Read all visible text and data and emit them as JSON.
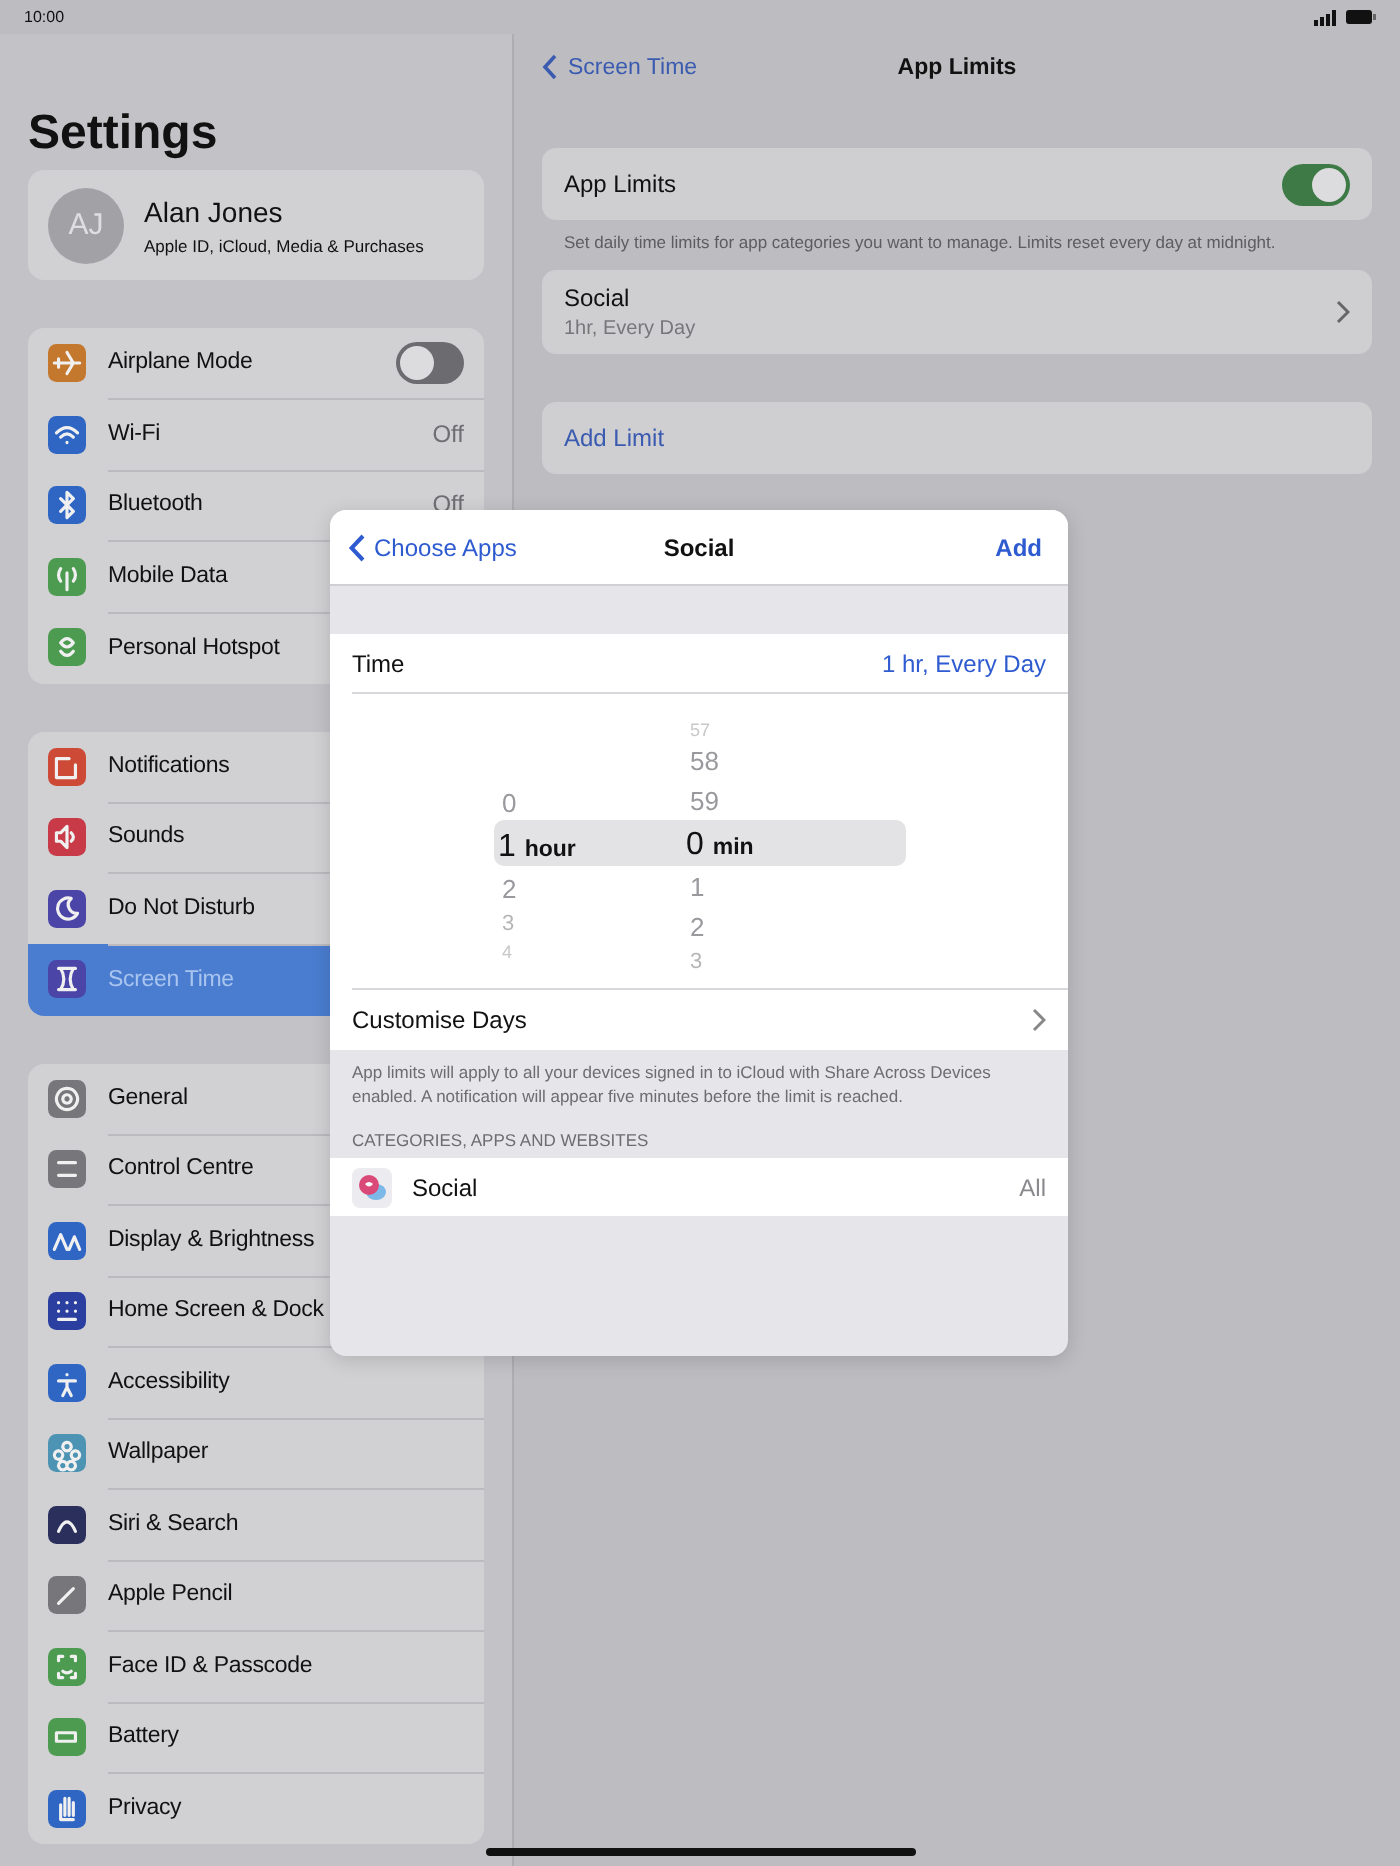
{
  "status_bar": {
    "time": "10:00"
  },
  "sidebar": {
    "title": "Settings",
    "profile": {
      "initials": "AJ",
      "name": "Alan Jones",
      "subtitle": "Apple ID, iCloud, Media & Purchases"
    },
    "groups": [
      [
        {
          "label": "Airplane Mode",
          "kind": "toggle",
          "on": false,
          "selected": false,
          "color": "#c4782e"
        },
        {
          "label": "Wi-Fi",
          "kind": "value",
          "value": "Off",
          "selected": false,
          "color": "#2f66c4"
        },
        {
          "label": "Bluetooth",
          "kind": "value",
          "value": "Off",
          "selected": false,
          "color": "#2f66c4"
        },
        {
          "label": "Mobile Data",
          "kind": "plain",
          "selected": false,
          "color": "#4c9b50"
        },
        {
          "label": "Personal Hotspot",
          "kind": "plain",
          "selected": false,
          "color": "#4c9b50"
        }
      ],
      [
        {
          "label": "Notifications",
          "kind": "plain",
          "selected": false,
          "color": "#cc4a36"
        },
        {
          "label": "Sounds",
          "kind": "plain",
          "selected": false,
          "color": "#c83a48"
        },
        {
          "label": "Do Not Disturb",
          "kind": "plain",
          "selected": false,
          "color": "#4b45a8"
        },
        {
          "label": "Screen Time",
          "kind": "plain",
          "selected": true,
          "color": "#4b45a8"
        }
      ],
      [
        {
          "label": "General",
          "kind": "plain",
          "selected": false,
          "color": "#77777b"
        },
        {
          "label": "Control Centre",
          "kind": "plain",
          "selected": false,
          "color": "#77777b"
        },
        {
          "label": "Display & Brightness",
          "kind": "plain",
          "selected": false,
          "color": "#2f66c4"
        },
        {
          "label": "Home Screen & Dock",
          "kind": "plain",
          "selected": false,
          "color": "#2a3fa0"
        },
        {
          "label": "Accessibility",
          "kind": "plain",
          "selected": false,
          "color": "#2f66c4"
        },
        {
          "label": "Wallpaper",
          "kind": "plain",
          "selected": false,
          "color": "#4d94b4"
        },
        {
          "label": "Siri & Search",
          "kind": "plain",
          "selected": false,
          "color": "#2a2f5c"
        },
        {
          "label": "Apple Pencil",
          "kind": "plain",
          "selected": false,
          "color": "#77777b"
        },
        {
          "label": "Face ID & Passcode",
          "kind": "plain",
          "selected": false,
          "color": "#4c9b50"
        },
        {
          "label": "Battery",
          "kind": "plain",
          "selected": false,
          "color": "#4c9b50"
        },
        {
          "label": "Privacy",
          "kind": "plain",
          "selected": false,
          "color": "#2f66c4"
        }
      ]
    ]
  },
  "detail": {
    "back": "Screen Time",
    "title": "App Limits",
    "toggle_row": {
      "label": "App Limits",
      "on": true
    },
    "note": "Set daily time limits for app categories you want to manage. Limits reset every day at midnight.",
    "limit": {
      "title": "Social",
      "subtitle": "1hr, Every Day"
    },
    "add": "Add Limit"
  },
  "sheet": {
    "back": "Choose Apps",
    "title": "Social",
    "action": "Add",
    "time": {
      "label": "Time",
      "value": "1 hr, Every Day"
    },
    "picker": {
      "hours": [
        {
          "text": "0",
          "selected": false
        },
        {
          "text": "1",
          "selected": true
        },
        {
          "text": "2",
          "selected": false
        },
        {
          "text": "3",
          "selected": false
        },
        {
          "text": "4",
          "selected": false
        }
      ],
      "hour_unit": "hour",
      "minutes": [
        {
          "text": "57",
          "selected": false
        },
        {
          "text": "58",
          "selected": false
        },
        {
          "text": "59",
          "selected": false
        },
        {
          "text": "0",
          "selected": true
        },
        {
          "text": "1",
          "selected": false
        },
        {
          "text": "2",
          "selected": false
        },
        {
          "text": "3",
          "selected": false
        }
      ],
      "minute_unit": "min"
    },
    "customise": "Customise Days",
    "footer": "App limits will apply to all your devices signed in to iCloud with Share Across Devices enabled. A notification will appear five minutes before the limit is reached.",
    "section": "CATEGORIES, APPS AND WEBSITES",
    "app": {
      "label": "Social",
      "value": "All"
    }
  }
}
